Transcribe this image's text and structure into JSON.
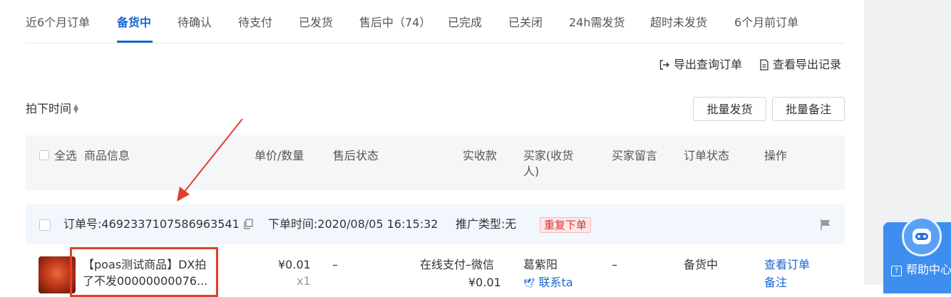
{
  "tabs": [
    {
      "label": "近6个月订单"
    },
    {
      "label": "备货中"
    },
    {
      "label": "待确认"
    },
    {
      "label": "待支付"
    },
    {
      "label": "已发货"
    },
    {
      "label": "售后中（74）"
    },
    {
      "label": "已完成"
    },
    {
      "label": "已关闭"
    },
    {
      "label": "24h需发货"
    },
    {
      "label": "超时未发货"
    },
    {
      "label": "6个月前订单"
    }
  ],
  "toolbar": {
    "export_query": "导出查询订单",
    "export_records": "查看导出记录",
    "sort_label": "拍下时间",
    "batch_ship": "批量发货",
    "batch_note": "批量备注"
  },
  "table": {
    "select_all": "全选",
    "columns": {
      "product": "商品信息",
      "price_qty": "单价/数量",
      "after_sale": "售后状态",
      "received": "实收款",
      "buyer_line1": "买家(收货",
      "buyer_line2": "人)",
      "message": "买家留言",
      "status": "订单状态",
      "action": "操作"
    }
  },
  "order": {
    "number_label": "订单号:",
    "number": "4692337107586963541",
    "time_label": "下单时间:",
    "time": "2020/08/05 16:15:32",
    "promo_label": "推广类型:",
    "promo": "无",
    "tag": "重复下单",
    "title_line1": "【poas测试商品】DX拍",
    "title_line2": "了不发00000000076...",
    "price": "¥0.01",
    "qty": "x1",
    "after_sale": "–",
    "payment": "在线支付–微信",
    "received": "¥0.01",
    "buyer": "葛紫阳",
    "contact": "联系ta",
    "message": "–",
    "status": "备货中",
    "view_order": "查看订单",
    "note": "备注"
  },
  "helper": {
    "label": "帮助中心"
  },
  "colors": {
    "accent": "#1966d2",
    "tag_red": "#e0302f",
    "annotation_red": "#e0402f",
    "helper_blue": "#3e8ef0"
  }
}
